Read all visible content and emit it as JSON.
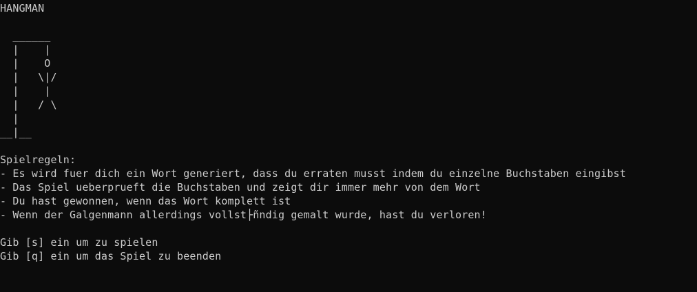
{
  "title": "HANGMAN",
  "drawing": [
    "",
    "  ______",
    "  |    |",
    "  |    O",
    "  |   \\|/",
    "  |    |",
    "  |   / \\",
    "  |",
    "__|__"
  ],
  "rules": {
    "heading": "Spielregeln:",
    "items": [
      "- Es wird fuer dich ein Wort generiert, dass du erraten musst indem du einzelne Buchstaben eingibst",
      "- Das Spiel ueberprueft die Buchstaben und zeigt dir immer mehr von dem Wort",
      "- Du hast gewonnen, wenn das Wort komplett ist",
      "- Wenn der Galgenmann allerdings vollst├ñndig gemalt wurde, hast du verloren!"
    ]
  },
  "prompts": {
    "play": "Gib [s] ein um zu spielen",
    "quit": "Gib [q] ein um das Spiel zu beenden"
  }
}
